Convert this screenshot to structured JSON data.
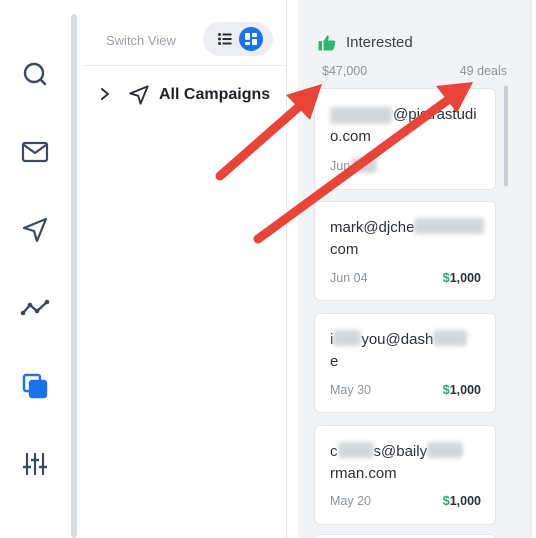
{
  "sidebar": {
    "icons": [
      "search-icon",
      "mail-icon",
      "send-icon",
      "analytics-icon",
      "copy-icon",
      "sliders-icon"
    ],
    "active_color": "#1a73e8",
    "inactive_color": "#3a4a5c"
  },
  "view": {
    "switch_label": "Switch View",
    "list_icon": "list-icon",
    "board_icon": "board-icon"
  },
  "campaigns": {
    "label": "All Campaigns"
  },
  "column": {
    "title": "Interested",
    "total_value": "$47,000",
    "deal_count": "49 deals",
    "accent": "#34b36f"
  },
  "cards": [
    {
      "email_prefix": "",
      "email_rest": "@pictrastudio.com",
      "date": "Jun 05",
      "currency": "",
      "amount": ""
    },
    {
      "email_prefix": "mark@djche",
      "email_rest": "com",
      "date": "Jun 04",
      "currency": "$",
      "amount": "1,000"
    },
    {
      "email_prefix": "i",
      "email_rest": "you@dash",
      "email_line2": "e",
      "date": "May 30",
      "currency": "$",
      "amount": "1,000"
    },
    {
      "email_prefix": "c",
      "email_rest": "s@baily",
      "email_line2": "rman.com",
      "date": "May 20",
      "currency": "$",
      "amount": "1,000"
    }
  ]
}
